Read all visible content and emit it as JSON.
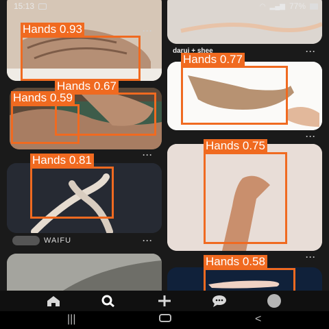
{
  "status": {
    "time": "15:13",
    "battery": "77%"
  },
  "cards": [
    {
      "id": "old-hands-top",
      "caption": ""
    },
    {
      "id": "joined-hands",
      "caption": "darui + shee"
    },
    {
      "id": "wrinkled-hands",
      "caption": ""
    },
    {
      "id": "reaching-hand",
      "caption": ""
    },
    {
      "id": "crossed-hands",
      "caption": ""
    },
    {
      "id": "raised-hand",
      "caption": ""
    },
    {
      "id": "arm-shadow",
      "caption": ""
    },
    {
      "id": "open-hand",
      "caption": ""
    }
  ],
  "more_label": "···",
  "profile": {
    "name": "WAIFU"
  },
  "detections": [
    {
      "label": "Hands 0.93"
    },
    {
      "label": "Hands 0.77"
    },
    {
      "label": "Hands 0.67"
    },
    {
      "label": "Hands 0.59"
    },
    {
      "label": "Hands 0.81"
    },
    {
      "label": "Hands 0.75"
    },
    {
      "label": "Hands 0.58"
    }
  ],
  "tabs": [
    {
      "name": "home",
      "icon": "home-icon"
    },
    {
      "name": "search",
      "icon": "search-icon"
    },
    {
      "name": "create",
      "icon": "plus-icon"
    },
    {
      "name": "messages",
      "icon": "chat-icon"
    },
    {
      "name": "profile",
      "icon": "avatar-icon"
    }
  ],
  "colors": {
    "detection": "#f06a20",
    "background": "#1a1a1a"
  }
}
